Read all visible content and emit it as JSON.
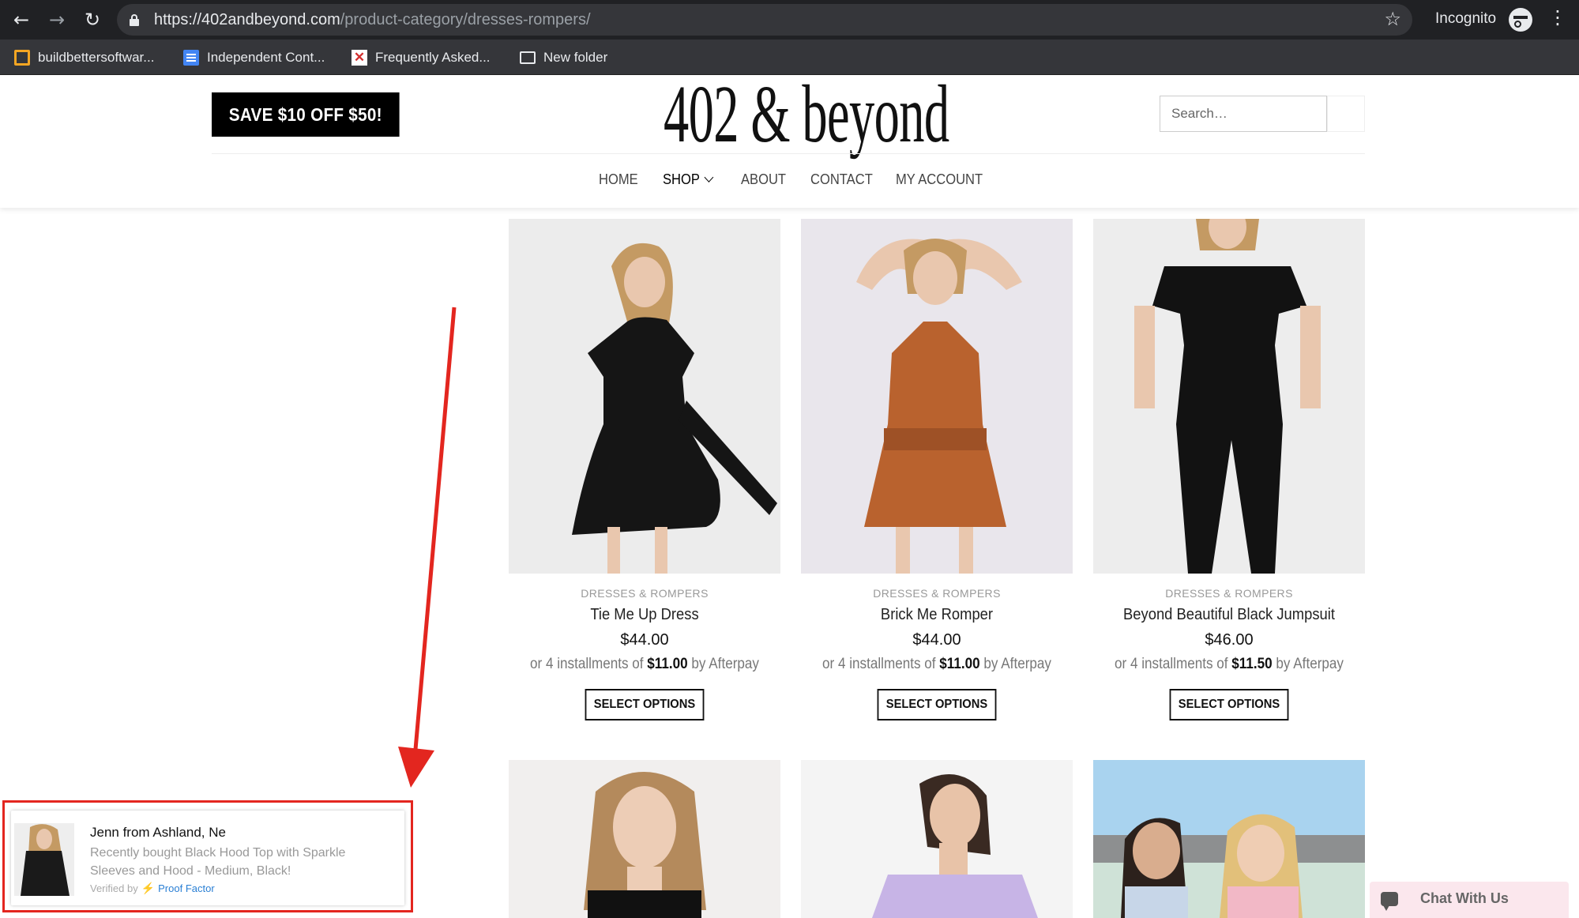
{
  "browser": {
    "url_host": "https://402andbeyond.com",
    "url_path": "/product-category/dresses-rompers/",
    "profile_label": "Incognito",
    "bookmarks": [
      {
        "label": "buildbettersoftwar...",
        "icon": "square-outline-icon"
      },
      {
        "label": "Independent Cont...",
        "icon": "google-docs-icon"
      },
      {
        "label": "Frequently Asked...",
        "icon": "x-logo-icon"
      },
      {
        "label": "New folder",
        "icon": "folder-icon"
      }
    ]
  },
  "header": {
    "promo_label": "SAVE $10 OFF $50!",
    "logo_text": "402 & beyond",
    "search_placeholder": "Search…",
    "nav": [
      "HOME",
      "SHOP",
      "ABOUT",
      "CONTACT",
      "MY ACCOUNT"
    ]
  },
  "products": [
    {
      "category": "DRESSES & ROMPERS",
      "name": "Tie Me Up Dress",
      "price": "$44.00",
      "after_pre": "or 4 installments of",
      "after_amount": "$11.00",
      "after_post": "by Afterpay",
      "button": "SELECT OPTIONS"
    },
    {
      "category": "DRESSES & ROMPERS",
      "name": "Brick Me Romper",
      "price": "$44.00",
      "after_pre": "or 4 installments of",
      "after_amount": "$11.00",
      "after_post": "by Afterpay",
      "button": "SELECT OPTIONS"
    },
    {
      "category": "DRESSES & ROMPERS",
      "name": "Beyond Beautiful Black Jumpsuit",
      "price": "$46.00",
      "after_pre": "or 4 installments of",
      "after_amount": "$11.50",
      "after_post": "by Afterpay",
      "button": "SELECT OPTIONS"
    }
  ],
  "popup": {
    "name": "Jenn from Ashland, Ne",
    "text": "Recently bought Black Hood Top with Sparkle Sleeves and Hood - Medium, Black!",
    "verified_label": "Verified by",
    "verified_brand": "Proof Factor"
  },
  "chat": {
    "label": "Chat With Us"
  },
  "colors": {
    "annotation_red": "#e3261f",
    "promo_bg": "#000000",
    "chat_bg": "#fbe7ed"
  }
}
